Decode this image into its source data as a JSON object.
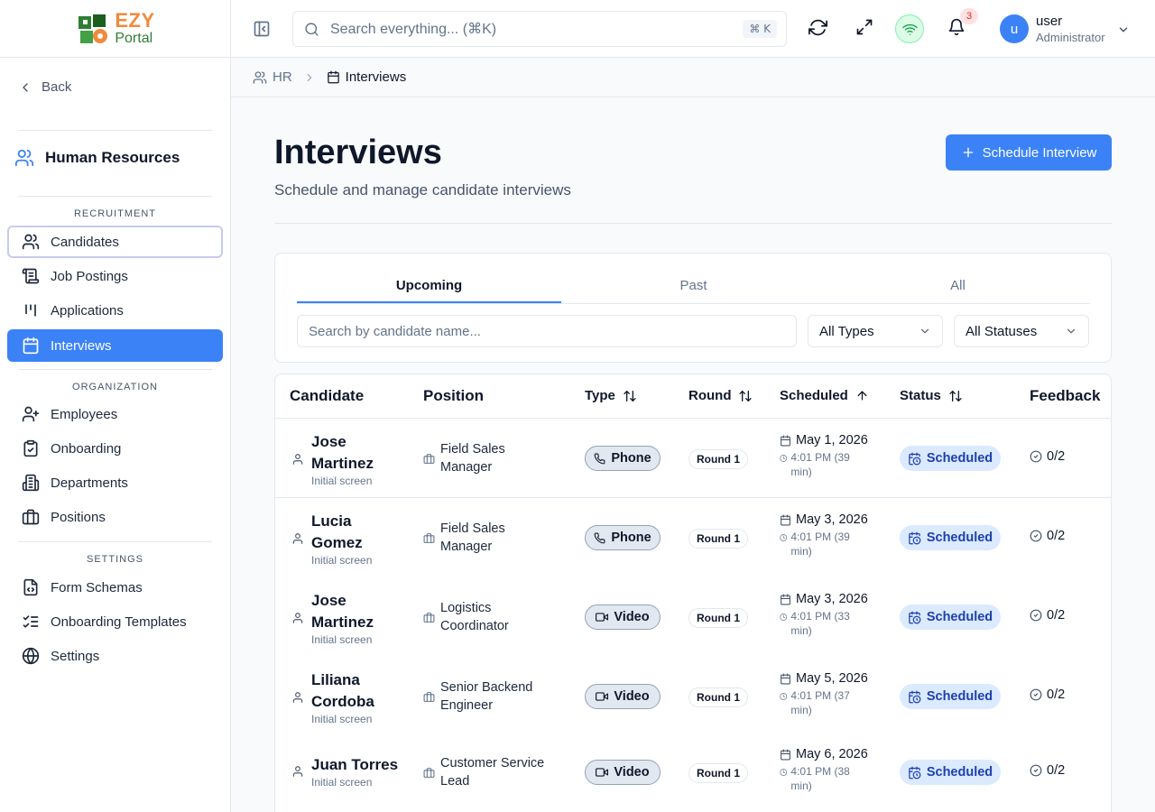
{
  "app": {
    "logo_top": "EZY",
    "logo_bottom": "Portal"
  },
  "sidebar": {
    "back_label": "Back",
    "module_title": "Human Resources",
    "sections": [
      {
        "label": "RECRUITMENT",
        "items": [
          {
            "label": "Candidates",
            "icon": "users-icon"
          },
          {
            "label": "Job Postings",
            "icon": "scroll-icon"
          },
          {
            "label": "Applications",
            "icon": "kanban-icon"
          },
          {
            "label": "Interviews",
            "icon": "calendar-icon",
            "active": true
          }
        ]
      },
      {
        "label": "ORGANIZATION",
        "items": [
          {
            "label": "Employees",
            "icon": "user-plus-icon"
          },
          {
            "label": "Onboarding",
            "icon": "clipboard-check-icon"
          },
          {
            "label": "Departments",
            "icon": "building-icon"
          },
          {
            "label": "Positions",
            "icon": "briefcase-icon"
          }
        ]
      },
      {
        "label": "SETTINGS",
        "items": [
          {
            "label": "Form Schemas",
            "icon": "file-code-icon"
          },
          {
            "label": "Onboarding Templates",
            "icon": "list-checks-icon"
          },
          {
            "label": "Settings",
            "icon": "globe-icon"
          }
        ]
      }
    ]
  },
  "header": {
    "search_placeholder": "Search everything... (⌘K)",
    "search_shortcut": "⌘ K",
    "notification_count": "3",
    "user_initial": "u",
    "user_name": "user",
    "user_role": "Administrator"
  },
  "breadcrumb": {
    "parent": "HR",
    "current": "Interviews"
  },
  "page": {
    "title": "Interviews",
    "subtitle": "Schedule and manage candidate interviews",
    "primary_action": "Schedule Interview"
  },
  "filters": {
    "tabs": [
      "Upcoming",
      "Past",
      "All"
    ],
    "active_tab": "Upcoming",
    "search_placeholder": "Search by candidate name...",
    "type_select": "All Types",
    "status_select": "All Statuses"
  },
  "table": {
    "columns": {
      "candidate": "Candidate",
      "position": "Position",
      "type": "Type",
      "round": "Round",
      "scheduled": "Scheduled",
      "status": "Status",
      "feedback": "Feedback"
    },
    "rows": [
      {
        "name": "Jose Martinez",
        "note": "Initial screen",
        "position": "Field Sales Manager",
        "type": "Phone",
        "round": "Round 1",
        "date": "May 1, 2026",
        "time": "4:01 PM (39 min)",
        "status": "Scheduled",
        "feedback": "0/2"
      },
      {
        "name": "Lucia Gomez",
        "note": "Initial screen",
        "position": "Field Sales Manager",
        "type": "Phone",
        "round": "Round 1",
        "date": "May 3, 2026",
        "time": "4:01 PM (39 min)",
        "status": "Scheduled",
        "feedback": "0/2"
      },
      {
        "name": "Jose Martinez",
        "note": "Initial screen",
        "position": "Logistics Coordinator",
        "type": "Video",
        "round": "Round 1",
        "date": "May 3, 2026",
        "time": "4:01 PM (33 min)",
        "status": "Scheduled",
        "feedback": "0/2"
      },
      {
        "name": "Liliana Cordoba",
        "note": "Initial screen",
        "position": "Senior Backend Engineer",
        "type": "Video",
        "round": "Round 1",
        "date": "May 5, 2026",
        "time": "4:01 PM (37 min)",
        "status": "Scheduled",
        "feedback": "0/2"
      },
      {
        "name": "Juan Torres",
        "note": "Initial screen",
        "position": "Customer Service Lead",
        "type": "Video",
        "round": "Round 1",
        "date": "May 6, 2026",
        "time": "4:01 PM (38 min)",
        "status": "Scheduled",
        "feedback": "0/2"
      }
    ]
  },
  "colors": {
    "accent": "#3b82f6",
    "status_bg": "#dbeafe",
    "status_text": "#1e40af"
  }
}
